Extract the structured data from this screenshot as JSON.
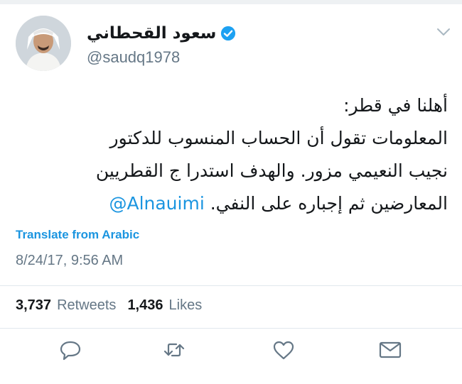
{
  "user": {
    "display_name": "سعود القحطاني",
    "handle": "@saudq1978",
    "verified": true
  },
  "tweet": {
    "lines": [
      "أهلنا في قطر:",
      "المعلومات تقول أن الحساب المنسوب للدكتور",
      "نجيب النعيمي مزور. والهدف استدرا ج القطريين",
      "المعارضين ثم إجباره على النفي."
    ],
    "mention": "@Alnauimi"
  },
  "translate_label": "Translate from Arabic",
  "timestamp": "8/24/17, 9:56 AM",
  "stats": {
    "retweets_count": "3,737",
    "retweets_label": "Retweets",
    "likes_count": "1,436",
    "likes_label": "Likes"
  },
  "icons": {
    "reply": "reply-icon",
    "retweet": "retweet-icon",
    "like": "heart-icon",
    "message": "envelope-icon",
    "menu": "chevron-down-icon",
    "verified": "verified-badge-icon"
  },
  "colors": {
    "link": "#1b95e0",
    "secondary_text": "#657786",
    "verified_badge": "#1da1f2",
    "icon_gray": "#657786"
  }
}
